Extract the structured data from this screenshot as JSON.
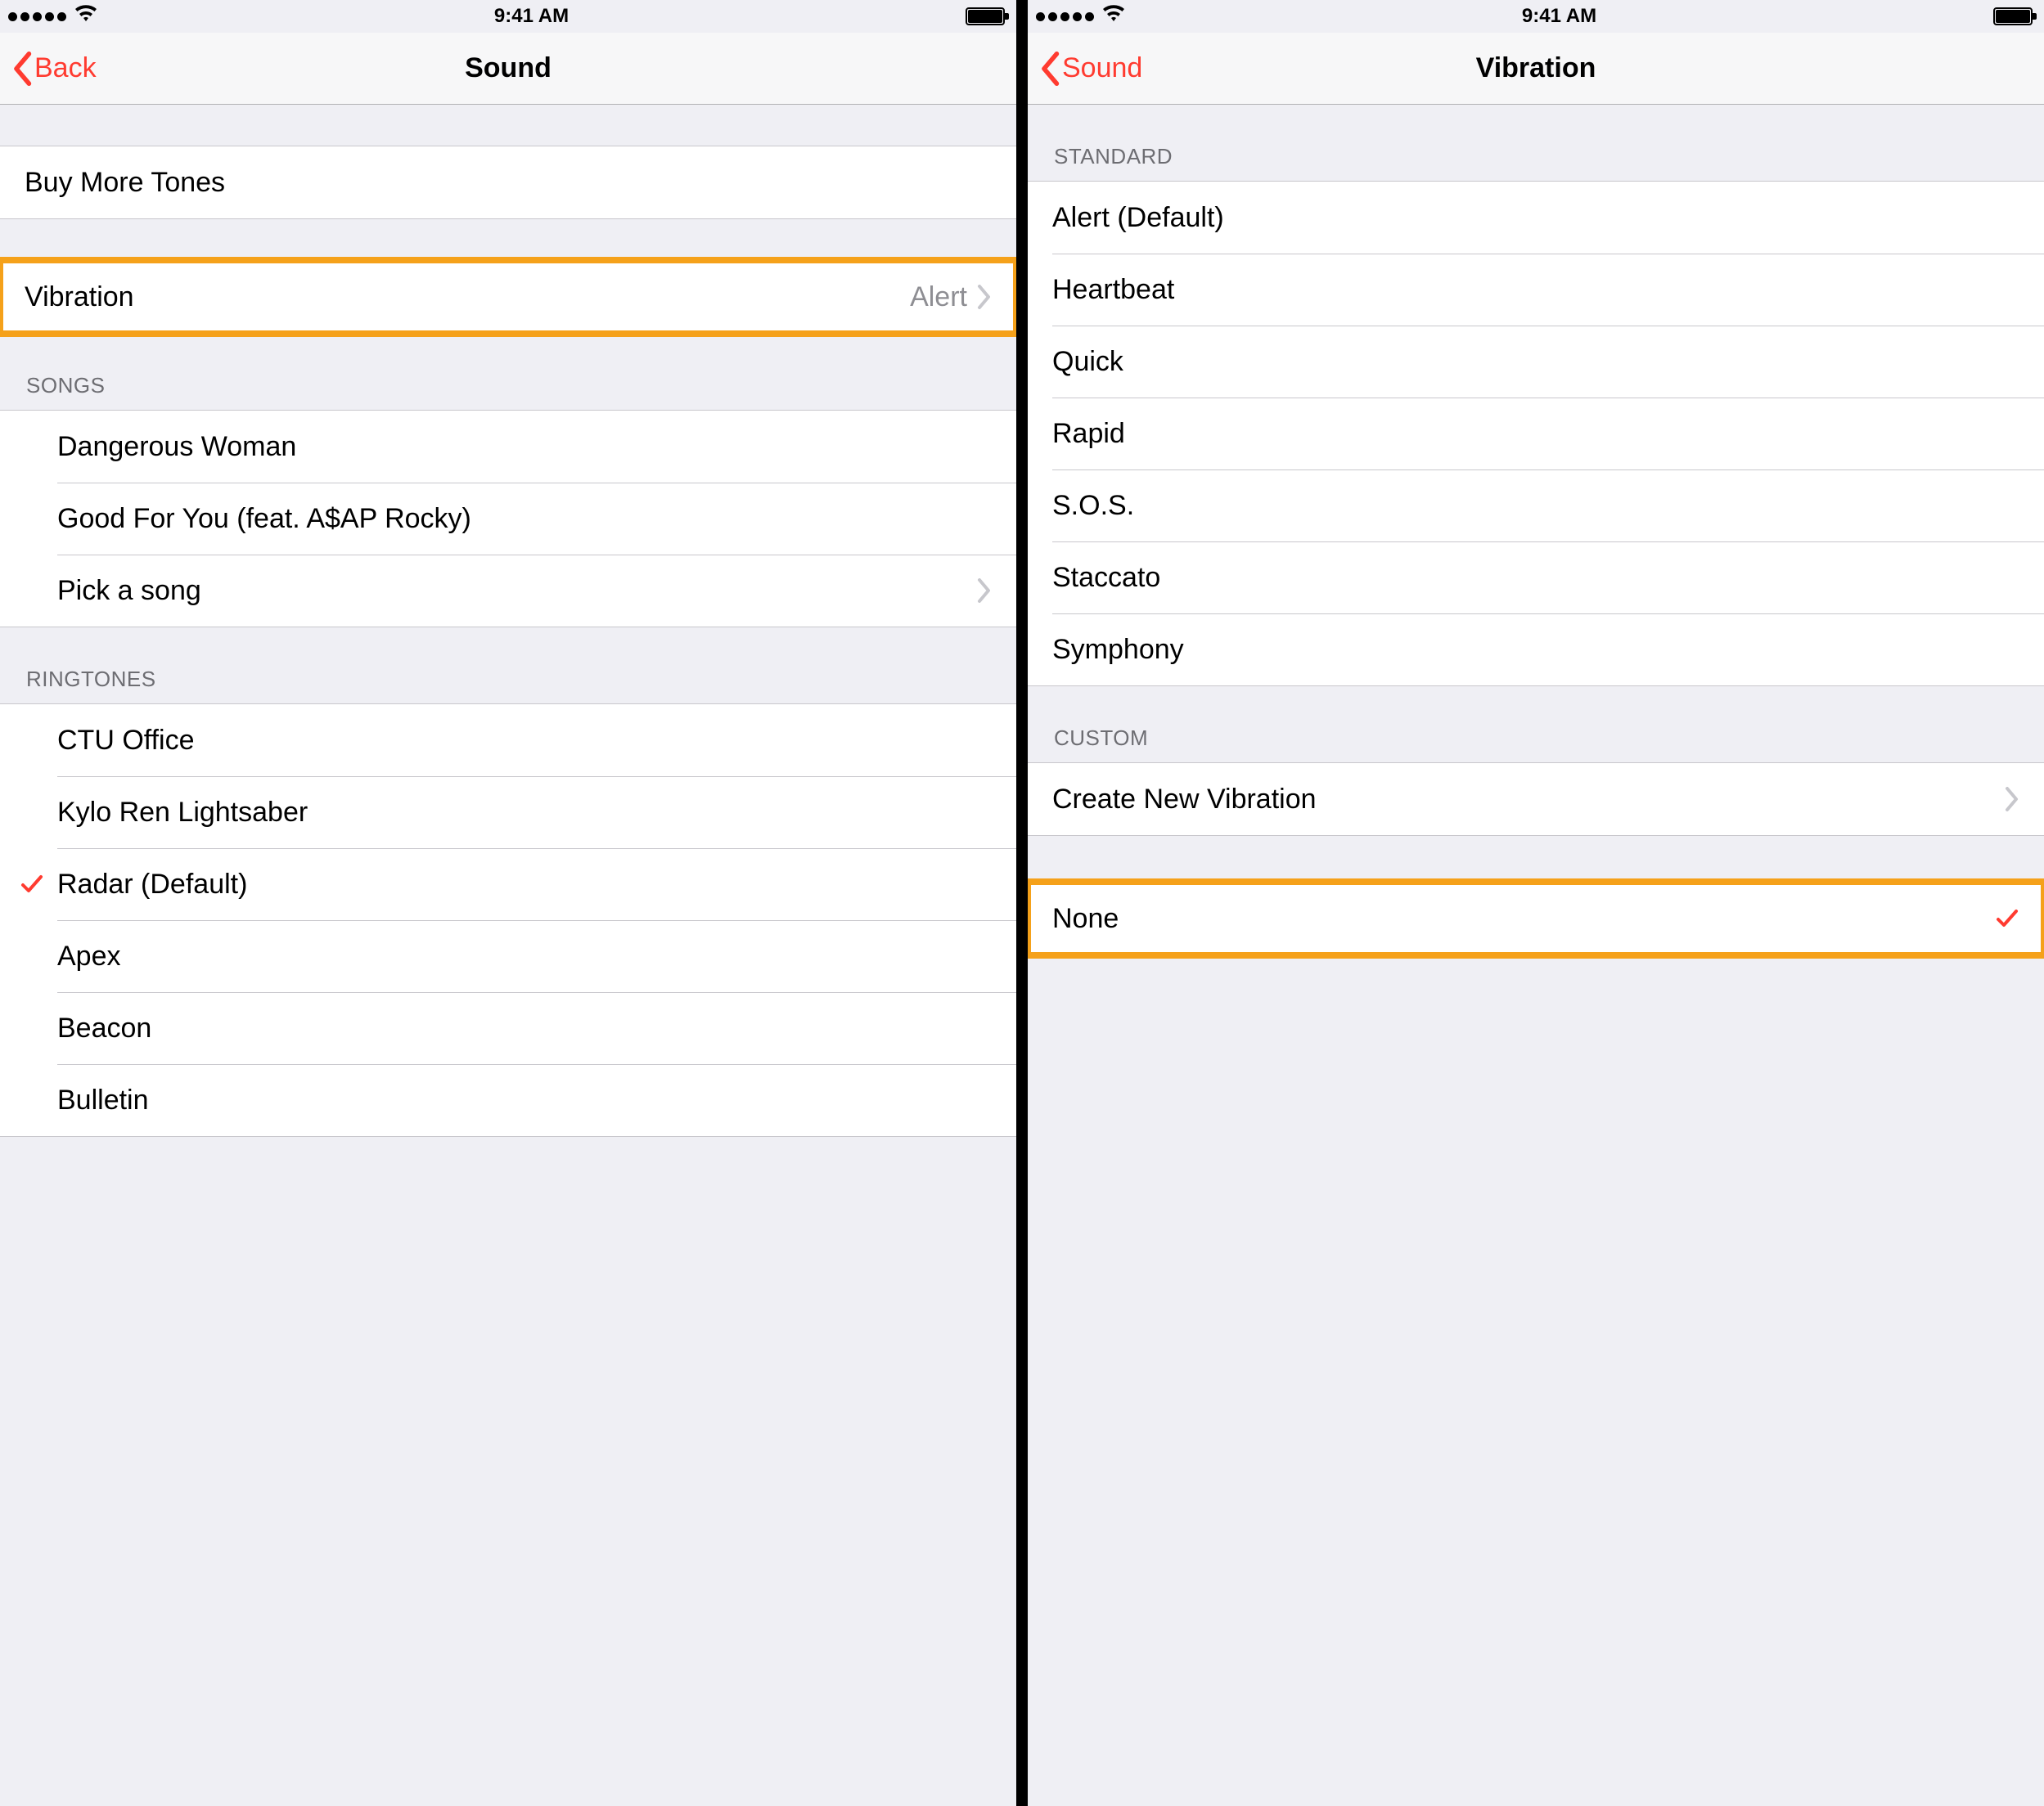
{
  "status": {
    "time": "9:41 AM"
  },
  "left_screen": {
    "nav": {
      "back": "Back",
      "title": "Sound"
    },
    "sections": {
      "top": {
        "buy_more": "Buy More Tones"
      },
      "vibration": {
        "label": "Vibration",
        "value": "Alert"
      },
      "songs": {
        "header": "SONGS",
        "items": [
          "Dangerous Woman",
          "Good For You (feat. A$AP Rocky)",
          "Pick a song"
        ]
      },
      "ringtones": {
        "header": "RINGTONES",
        "items": [
          "CTU Office",
          "Kylo Ren Lightsaber",
          "Radar (Default)",
          "Apex",
          "Beacon",
          "Bulletin"
        ],
        "selected": "Radar (Default)"
      }
    }
  },
  "right_screen": {
    "nav": {
      "back": "Sound",
      "title": "Vibration"
    },
    "sections": {
      "standard": {
        "header": "STANDARD",
        "items": [
          "Alert (Default)",
          "Heartbeat",
          "Quick",
          "Rapid",
          "S.O.S.",
          "Staccato",
          "Symphony"
        ]
      },
      "custom": {
        "header": "CUSTOM",
        "create": "Create New Vibration"
      },
      "none": {
        "label": "None"
      }
    }
  }
}
